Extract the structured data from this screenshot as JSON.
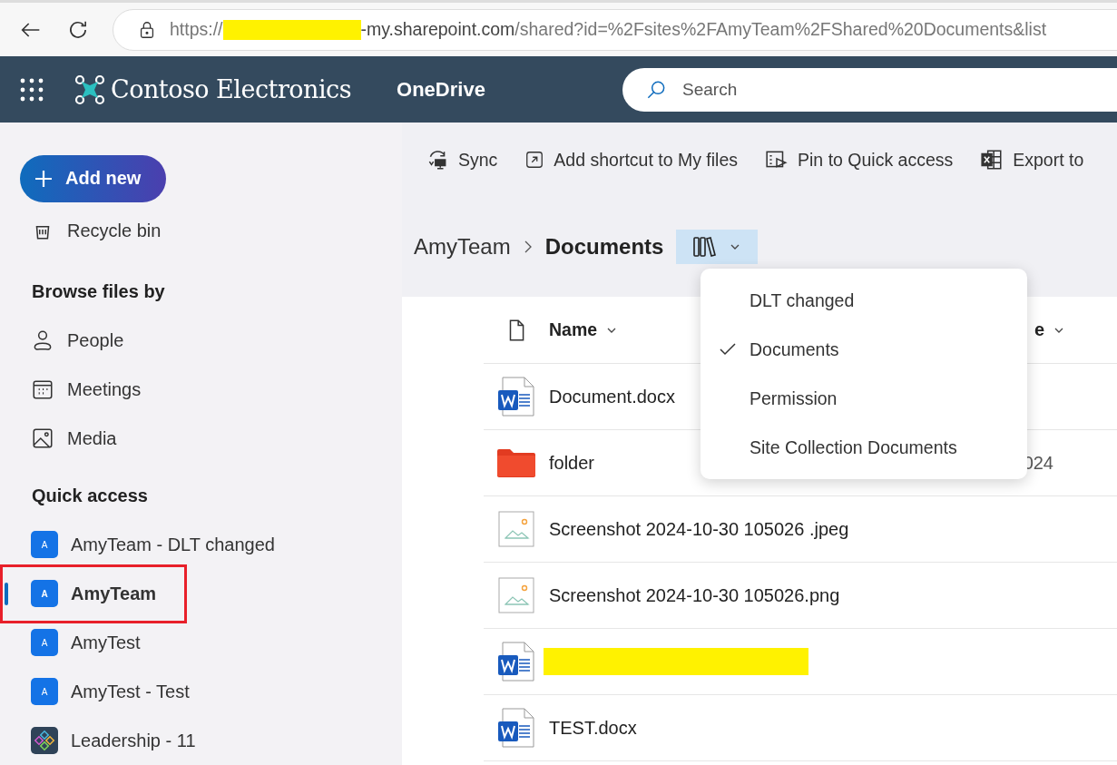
{
  "browser": {
    "url": {
      "scheme": "https://",
      "redacted": true,
      "host": "-my.sharepoint.com",
      "path": "/shared?id=%2Fsites%2FAmyTeam%2FShared%20Documents&list"
    }
  },
  "suite_header": {
    "brand": "Contoso Electronics",
    "app": "OneDrive",
    "search": {
      "placeholder": "Search"
    }
  },
  "sidebar": {
    "add_button": "Add new",
    "top_items": [
      {
        "label": "Recycle bin"
      }
    ],
    "sections": [
      {
        "heading": "Browse files by",
        "items": [
          {
            "label": "People",
            "selected": false,
            "annotated": false
          },
          {
            "label": "Meetings",
            "selected": false,
            "annotated": false
          },
          {
            "label": "Media",
            "selected": false,
            "annotated": false
          }
        ]
      },
      {
        "heading": "Quick access",
        "items": [
          {
            "label": "AmyTeam - DLT changed",
            "kind": "letter",
            "initial": "A",
            "selected": false,
            "annotated": false
          },
          {
            "label": "AmyTeam",
            "kind": "letter",
            "initial": "A",
            "selected": true,
            "annotated": true
          },
          {
            "label": "AmyTest",
            "kind": "letter",
            "initial": "A",
            "selected": false,
            "annotated": false
          },
          {
            "label": "AmyTest - Test",
            "kind": "letter",
            "initial": "A",
            "selected": false,
            "annotated": false
          },
          {
            "label": "Leadership - 11",
            "kind": "logo",
            "selected": false,
            "annotated": false
          }
        ]
      }
    ]
  },
  "toolbar": [
    {
      "label": "Sync"
    },
    {
      "label": "Add shortcut to My files"
    },
    {
      "label": "Pin to Quick access"
    },
    {
      "label": "Export to"
    }
  ],
  "breadcrumb": {
    "parent": "AmyTeam",
    "current": "Documents"
  },
  "library_menu": {
    "expanded": true,
    "items": [
      {
        "label": "DLT changed",
        "selected": false
      },
      {
        "label": "Documents",
        "selected": true
      },
      {
        "label": "Permission",
        "selected": false
      },
      {
        "label": "Site Collection Documents",
        "selected": false
      }
    ]
  },
  "table": {
    "columns": [
      {
        "label": "Name"
      },
      {
        "label": "e"
      }
    ],
    "rows": [
      {
        "kind": "word",
        "name": "Document.docx",
        "redacted": false
      },
      {
        "kind": "folder",
        "name": "folder",
        "column_2": "024",
        "redacted": false
      },
      {
        "kind": "image",
        "name": "Screenshot 2024-10-30 105026 .jpeg",
        "redacted": false
      },
      {
        "kind": "image",
        "name": "Screenshot 2024-10-30 105026.png",
        "redacted": false
      },
      {
        "kind": "word",
        "redacted": true
      },
      {
        "kind": "word",
        "name": "TEST.docx",
        "redacted": false
      }
    ]
  }
}
